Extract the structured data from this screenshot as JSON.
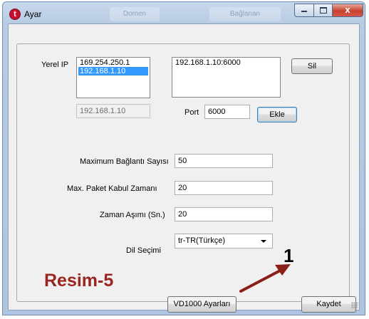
{
  "window": {
    "title": "Ayar",
    "background_tabs": [
      "Domen",
      "Bağlanan"
    ],
    "close_label": "x"
  },
  "form": {
    "local_ip_label": "Yerel IP",
    "local_ip_list": [
      "169.254.250.1",
      "192.168.1.10"
    ],
    "local_ip_selected_index": 1,
    "selected_ip_value": "192.168.1.10",
    "remote_list": [
      "192.168.1.10:6000"
    ],
    "delete_button": "Sil",
    "port_label": "Port",
    "port_value": "6000",
    "add_button": "Ekle",
    "max_connections_label": "Maximum Bağlantı Sayısı",
    "max_connections_value": "50",
    "max_packet_time_label": "Max. Paket Kabul Zamanı",
    "max_packet_time_value": "20",
    "timeout_label": "Zaman Aşımı (Sn.)",
    "timeout_value": "20",
    "language_label": "Dil Seçimi",
    "language_value": "tr-TR(Türkçe)"
  },
  "footer": {
    "vd_settings_button": "VD1000 Ayarları",
    "save_button": "Kaydet"
  },
  "annotations": {
    "label": "Resim-5",
    "marker": "1",
    "color": "#9a2620"
  }
}
